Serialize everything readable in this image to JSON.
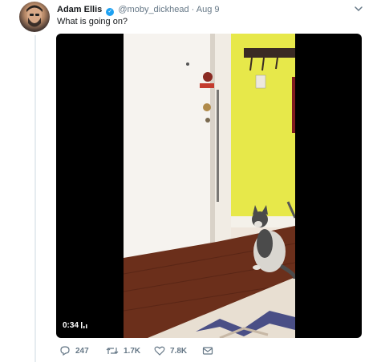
{
  "tweet": {
    "author_name": "Adam Ellis",
    "verified_glyph": "✓",
    "handle": "@moby_dickhead",
    "separator": "·",
    "date": "Aug 9",
    "text": "What is going on?",
    "menu_icon": "chevron-down-icon"
  },
  "video": {
    "duration": "0:34",
    "scene": "cat-by-door"
  },
  "actions": {
    "reply_count": "247",
    "retweet_count": "1.7K",
    "like_count": "7.8K"
  },
  "colors": {
    "accent": "#1da1f2",
    "muted": "#657786",
    "wall_yellow": "#e7e84a"
  }
}
